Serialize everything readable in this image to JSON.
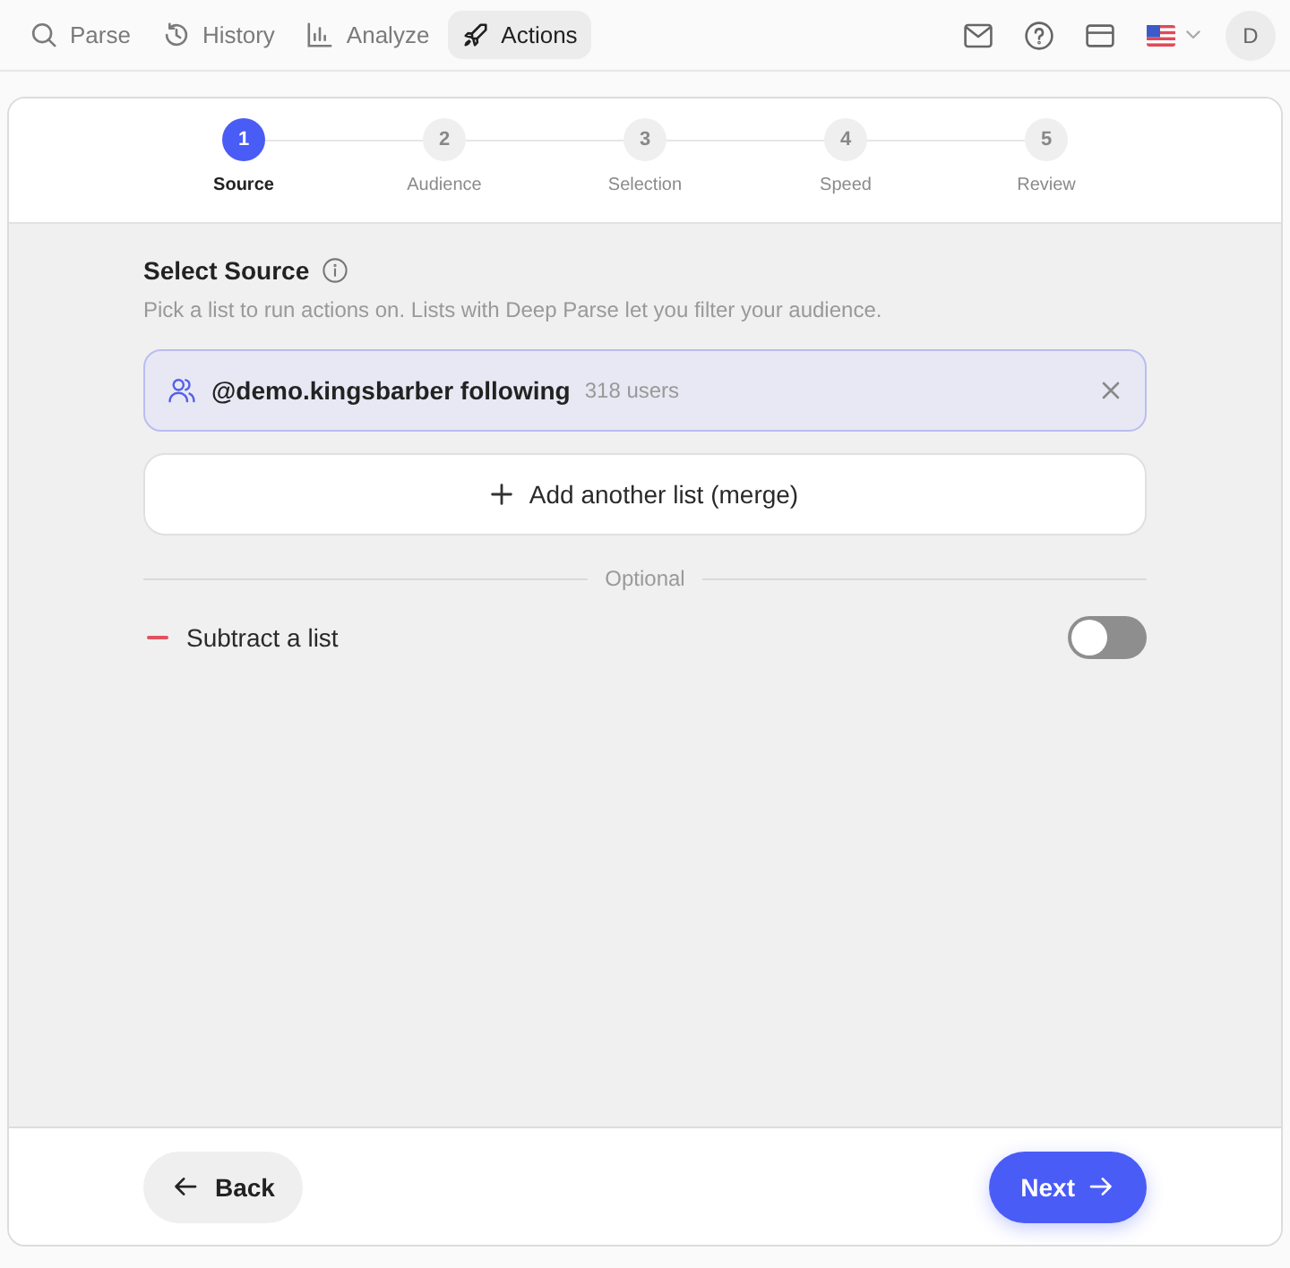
{
  "nav": {
    "items": [
      {
        "label": "Parse",
        "selected": false
      },
      {
        "label": "History",
        "selected": false
      },
      {
        "label": "Analyze",
        "selected": false
      },
      {
        "label": "Actions",
        "selected": true
      }
    ]
  },
  "account": {
    "avatar_initial": "D"
  },
  "stepper": {
    "steps": [
      {
        "number": "1",
        "label": "Source",
        "selected": true
      },
      {
        "number": "2",
        "label": "Audience",
        "selected": false
      },
      {
        "number": "3",
        "label": "Selection",
        "selected": false
      },
      {
        "number": "4",
        "label": "Speed",
        "selected": false
      },
      {
        "number": "5",
        "label": "Review",
        "selected": false
      }
    ]
  },
  "source": {
    "title": "Select Source",
    "description": "Pick a list to run actions on. Lists with Deep Parse let you filter your audience.",
    "lists": [
      {
        "name": "@demo.kingsbarber following",
        "count": "318 users"
      }
    ],
    "add_button": "Add another list (merge)",
    "divider_label": "Optional",
    "subtract": {
      "label": "Subtract a list",
      "on": false
    }
  },
  "footer": {
    "back_button": "Back",
    "next_button": "Next"
  }
}
